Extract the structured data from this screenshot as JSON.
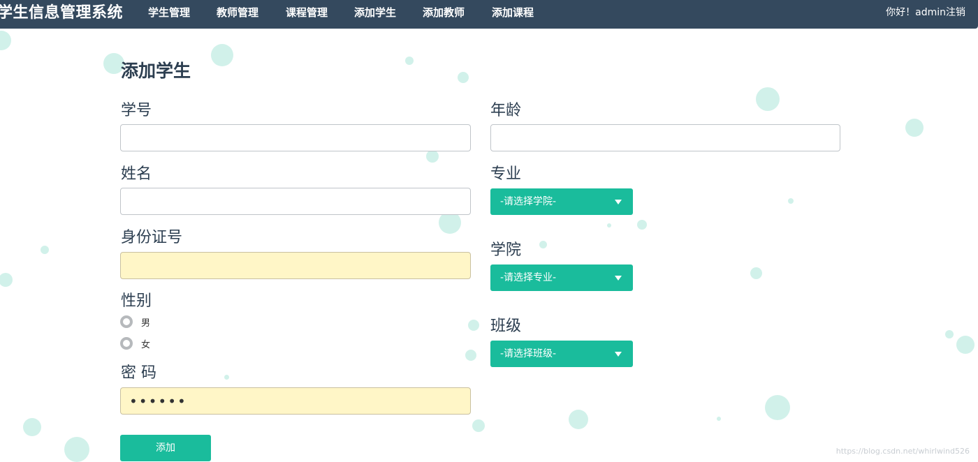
{
  "navbar": {
    "brand": "学生信息管理系统",
    "items": [
      "学生管理",
      "教师管理",
      "课程管理",
      "添加学生",
      "添加教师",
      "添加课程"
    ],
    "greeting": "你好！admin",
    "logout": "注销"
  },
  "form": {
    "title": "添加学生",
    "student_id_label": "学号",
    "name_label": "姓名",
    "id_card_label": "身份证号",
    "gender_label": "性别",
    "gender_options": [
      "男",
      "女"
    ],
    "password_label": "密 码",
    "password_value": "123456",
    "age_label": "年龄",
    "major_label": "专业",
    "major_select": "-请选择学院-",
    "college_label": "学院",
    "college_select": "-请选择专业-",
    "class_label": "班级",
    "class_select": "-请选择班级-",
    "submit": "添加"
  },
  "watermark": "https://blog.csdn.net/whirlwind526",
  "colors": {
    "navbar": "#34495e",
    "accent": "#1abc9c",
    "autofill": "#fff6c7"
  }
}
